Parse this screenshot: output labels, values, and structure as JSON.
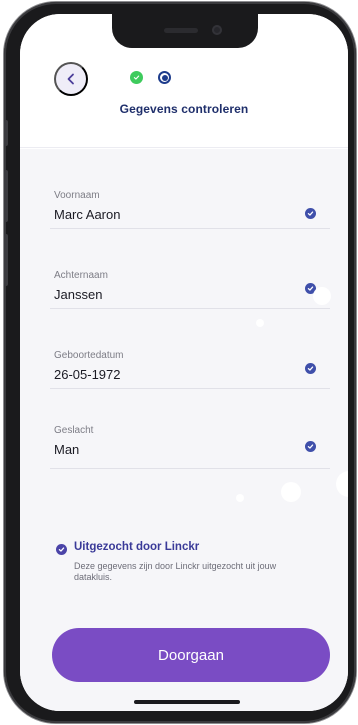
{
  "header": {
    "title": "Gegevens controleren",
    "back_icon": "chevron-left-icon",
    "steps": [
      {
        "state": "done",
        "color": "#3ecb5d"
      },
      {
        "state": "current",
        "color": "#1d3c8c"
      }
    ]
  },
  "fields": [
    {
      "label": "Voornaam",
      "value": "Marc Aaron",
      "verified": true
    },
    {
      "label": "Achternaam",
      "value": "Janssen",
      "verified": true
    },
    {
      "label": "Geboortedatum",
      "value": "26-05-1972",
      "verified": true
    },
    {
      "label": "Geslacht",
      "value": "Man",
      "verified": true
    }
  ],
  "info": {
    "title": "Uitgezocht door Linckr",
    "text": "Deze gegevens zijn door Linckr uitgezocht uit jouw datakluis.",
    "icon": "check-circle-icon"
  },
  "cta": {
    "label": "Doorgaan"
  },
  "colors": {
    "accent": "#7a4cc4",
    "title": "#1f2f6b",
    "check": "#3f4faa",
    "step_done": "#3ecb5d"
  }
}
